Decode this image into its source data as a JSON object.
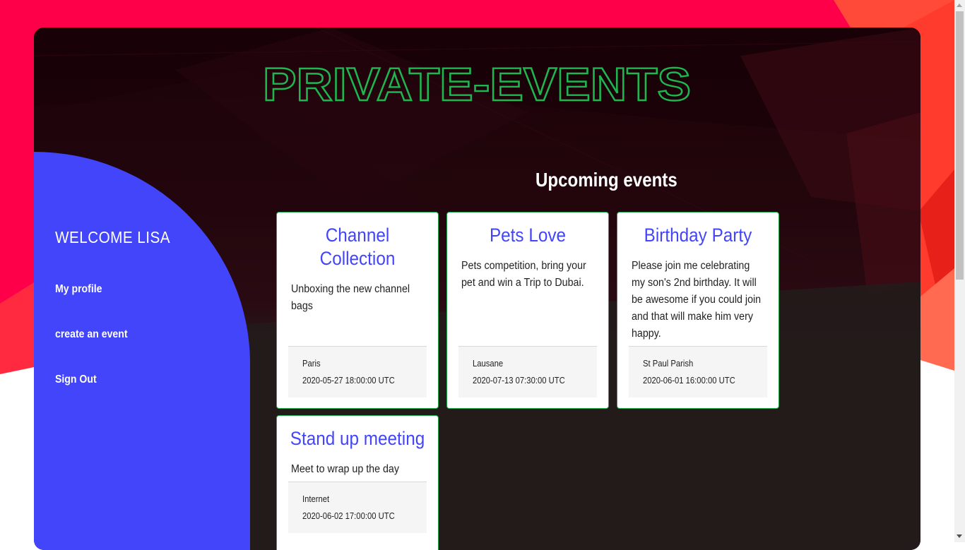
{
  "app": {
    "logo_text": "PRIVATE-EVENTS"
  },
  "sidebar": {
    "welcome": "WELCOME LISA",
    "links": [
      {
        "label": "My profile"
      },
      {
        "label": "create an event"
      },
      {
        "label": "Sign Out"
      }
    ]
  },
  "main": {
    "section_title": "Upcoming events",
    "events": [
      {
        "title": "Channel Collection",
        "description": "Unboxing the new channel bags",
        "location": "Paris",
        "date": "2020-05-27 18:00:00 UTC"
      },
      {
        "title": "Pets Love",
        "description": "Pets competition, bring your pet and win a Trip to Dubai.",
        "location": "Lausane",
        "date": "2020-07-13 07:30:00 UTC"
      },
      {
        "title": "Birthday Party",
        "description": "Please join me celebrating my son's 2nd birthday. It will be awesome if you could join and that will make him very happy.",
        "location": "St Paul Parish",
        "date": "2020-06-01 16:00:00 UTC"
      },
      {
        "title": "Stand up meeting",
        "description": "Meet to wrap up the day",
        "location": "Internet",
        "date": "2020-06-02 17:00:00 UTC"
      }
    ]
  },
  "colors": {
    "accent": "#4245fa",
    "logo_green": "#1fb54f",
    "background_red": "#ff0050"
  }
}
